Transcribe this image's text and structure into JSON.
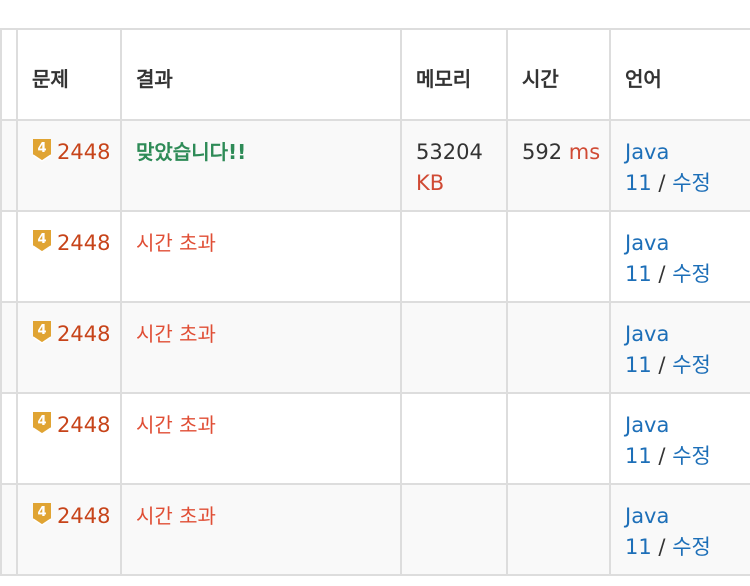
{
  "headers": [
    "문제",
    "결과",
    "메모리",
    "시간",
    "언어"
  ],
  "tier_icon": {
    "name": "gold-tier-icon",
    "level": "4",
    "color": "#e0a433"
  },
  "rows": [
    {
      "problem": "2448",
      "result": "맞았습니다!!",
      "result_type": "ok",
      "memory": "53204",
      "memory_unit": "KB",
      "time": "592",
      "time_unit": "ms",
      "lang_a": "Java",
      "lang_b": "11",
      "slash": "/",
      "edit": "수정"
    },
    {
      "problem": "2448",
      "result": "시간 초과",
      "result_type": "tle",
      "memory": "",
      "memory_unit": "",
      "time": "",
      "time_unit": "",
      "lang_a": "Java",
      "lang_b": "11",
      "slash": "/",
      "edit": "수정"
    },
    {
      "problem": "2448",
      "result": "시간 초과",
      "result_type": "tle",
      "memory": "",
      "memory_unit": "",
      "time": "",
      "time_unit": "",
      "lang_a": "Java",
      "lang_b": "11",
      "slash": "/",
      "edit": "수정"
    },
    {
      "problem": "2448",
      "result": "시간 초과",
      "result_type": "tle",
      "memory": "",
      "memory_unit": "",
      "time": "",
      "time_unit": "",
      "lang_a": "Java",
      "lang_b": "11",
      "slash": "/",
      "edit": "수정"
    },
    {
      "problem": "2448",
      "result": "시간 초과",
      "result_type": "tle",
      "memory": "",
      "memory_unit": "",
      "time": "",
      "time_unit": "",
      "lang_a": "Java",
      "lang_b": "11",
      "slash": "/",
      "edit": "수정"
    }
  ]
}
